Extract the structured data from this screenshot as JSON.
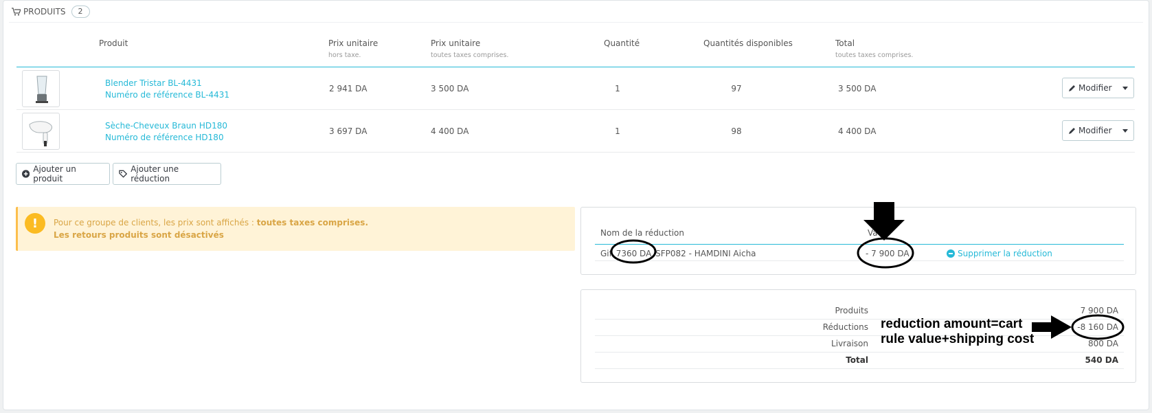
{
  "panel": {
    "title": "PRODUITS",
    "count": "2"
  },
  "table": {
    "headers": [
      {
        "label": "Produit",
        "sub": ""
      },
      {
        "label": "Prix unitaire",
        "sub": "hors taxe."
      },
      {
        "label": "Prix unitaire",
        "sub": "toutes taxes comprises."
      },
      {
        "label": "Quantité",
        "sub": ""
      },
      {
        "label": "Quantités disponibles",
        "sub": ""
      },
      {
        "label": "Total",
        "sub": "toutes taxes comprises."
      }
    ],
    "rows": [
      {
        "name": "Blender Tristar BL-4431",
        "ref": "Numéro de référence BL-4431",
        "price_ht": "2 941 DA",
        "price_ttc": "3 500 DA",
        "qty": "1",
        "stock": "97",
        "total": "3 500 DA",
        "action": "Modifier",
        "image_icon": "blender-icon"
      },
      {
        "name": "Sèche-Cheveux Braun HD180",
        "ref": "Numéro de référence HD180",
        "price_ht": "3 697 DA",
        "price_ttc": "4 400 DA",
        "qty": "1",
        "stock": "98",
        "total": "4 400 DA",
        "action": "Modifier",
        "image_icon": "hair-dryer-icon"
      }
    ]
  },
  "buttons": {
    "add_product": "Ajouter un produit",
    "add_discount": "Ajouter une réduction"
  },
  "alert": {
    "line1_prefix": "Pour ce groupe de clients, les prix sont affichés : ",
    "line1_bold": "toutes taxes comprises.",
    "line2": "Les retours produits sont désactivés"
  },
  "discounts": {
    "col_name": "Nom de la réduction",
    "col_value": "Va",
    "rows": [
      {
        "name_prefix": "Gif",
        "name_circled": "7360 DA",
        "name_suffix": "SFP082 - HAMDINI Aicha",
        "value": "- 7 900 DA",
        "remove": "Supprimer la réduction"
      }
    ]
  },
  "summary": {
    "rows": [
      {
        "label": "Produits",
        "value": "7 900 DA"
      },
      {
        "label": "Réductions",
        "value": "-8 160 DA"
      },
      {
        "label": "Livraison",
        "value": "800 DA"
      },
      {
        "label": "Total",
        "value": "540 DA"
      }
    ]
  },
  "annotation": {
    "text": "reduction amount=cart rule value+shipping cost"
  },
  "colors": {
    "link": "#25b9d7",
    "alert_bg": "#fff3d7",
    "alert_text": "#d9a545",
    "annotation": "#000000"
  }
}
